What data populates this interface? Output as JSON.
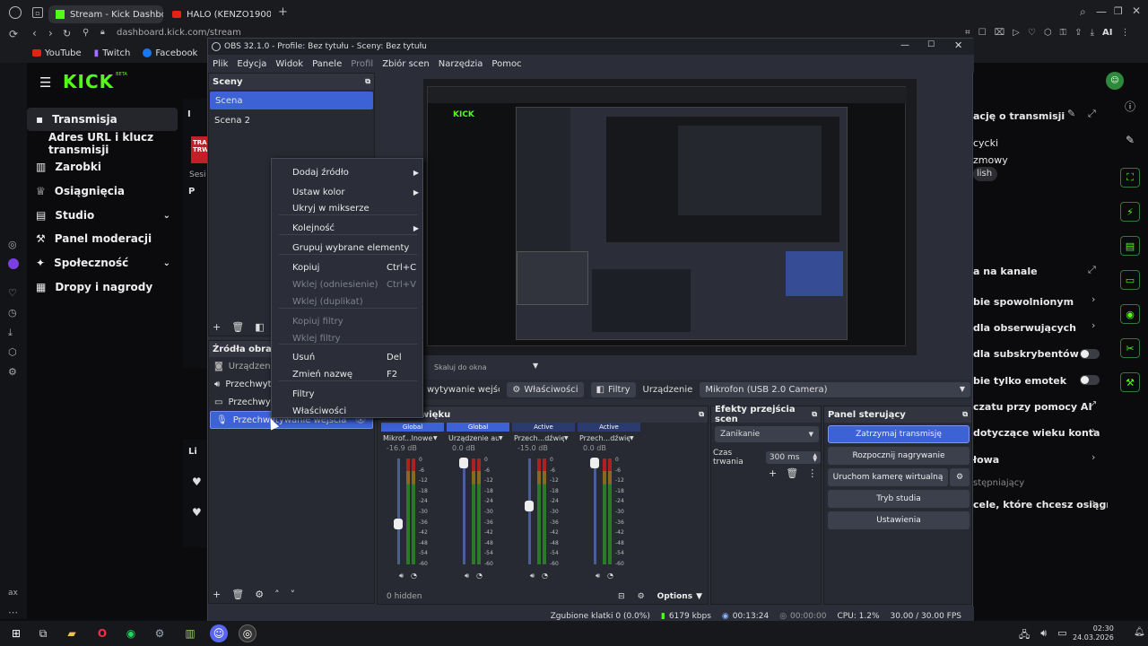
{
  "browser": {
    "tabs": [
      {
        "title": "Stream - Kick Dashboard"
      },
      {
        "title": "HALO (KENZO1900X) ORG"
      }
    ],
    "url": "dashboard.kick.com/stream",
    "url_host": "kick.com",
    "bookmarks": [
      "YouTube",
      "Twitch",
      "Facebook",
      "Oc"
    ],
    "ai_label": "AI"
  },
  "kick": {
    "logo": "KICK",
    "logo_sub": "BETA",
    "nav": [
      {
        "label": "Transmisja",
        "icon": "broadcast-icon"
      },
      {
        "label": "Adres URL i klucz transmisji",
        "icon": ""
      },
      {
        "label": "Zarobki",
        "icon": "chart-icon"
      },
      {
        "label": "Osiągnięcia",
        "icon": "trophy-icon"
      },
      {
        "label": "Studio",
        "icon": "studio-icon"
      },
      {
        "label": "Panel moderacji",
        "icon": "wrench-icon"
      },
      {
        "label": "Społeczność",
        "icon": "community-icon"
      },
      {
        "label": "Dropy i nagrody",
        "icon": "gift-icon"
      }
    ],
    "peek": {
      "i": "I",
      "tra": "TRA",
      "trw": "TRW",
      "sesi": "Sesi",
      "p": "P",
      "li": "Li"
    },
    "right": {
      "info_title": "ację o transmisji",
      "items1": [
        "cycki",
        "zmowy",
        "lish"
      ],
      "channel_title": "a na kanale",
      "items2": [
        "bie spowolnionym",
        "dla obserwujących",
        "dla subskrybentów",
        "bie tylko emotek",
        "czatu przy pomocy AI",
        "dotyczące wieku konta",
        "łowa",
        "stępniający",
        "cele, które chcesz osiągnąć"
      ]
    }
  },
  "obs": {
    "title": "OBS 32.1.0 - Profile: Bez tytułu - Sceny: Bez tytułu",
    "menu": [
      "Plik",
      "Edycja",
      "Widok",
      "Panele",
      "Profil",
      "Zbiór scen",
      "Narzędzia",
      "Pomoc"
    ],
    "scenes_title": "Sceny",
    "scenes": [
      "Scena",
      "Scena 2"
    ],
    "sources_title": "Źródła obrazu",
    "sources": [
      "Urządzenie c",
      "Przechwyty",
      "Przechwyty",
      "Przechwytywanie wejścia dźwię"
    ],
    "context_menu": [
      {
        "label": "Dodaj źródło",
        "shortcut": "",
        "submenu": true,
        "disabled": false
      },
      {
        "label": "Ustaw kolor",
        "shortcut": "",
        "submenu": true,
        "disabled": false
      },
      {
        "label": "Ukryj w mikserze",
        "shortcut": "",
        "submenu": false,
        "disabled": false
      },
      {
        "label": "Kolejność",
        "shortcut": "",
        "submenu": true,
        "disabled": false
      },
      {
        "label": "Grupuj wybrane elementy",
        "shortcut": "",
        "submenu": false,
        "disabled": false
      },
      {
        "label": "Kopiuj",
        "shortcut": "Ctrl+C",
        "submenu": false,
        "disabled": false
      },
      {
        "label": "Wklej (odniesienie)",
        "shortcut": "Ctrl+V",
        "submenu": false,
        "disabled": true
      },
      {
        "label": "Wklej (duplikat)",
        "shortcut": "",
        "submenu": false,
        "disabled": true
      },
      {
        "label": "Kopiuj filtry",
        "shortcut": "",
        "submenu": false,
        "disabled": true
      },
      {
        "label": "Wklej filtry",
        "shortcut": "",
        "submenu": false,
        "disabled": true
      },
      {
        "label": "Usuń",
        "shortcut": "Del",
        "submenu": false,
        "disabled": false
      },
      {
        "label": "Zmień nazwę",
        "shortcut": "F2",
        "submenu": false,
        "disabled": false
      },
      {
        "label": "Filtry",
        "shortcut": "",
        "submenu": false,
        "disabled": false
      },
      {
        "label": "Właściwości",
        "shortcut": "",
        "submenu": false,
        "disabled": false
      }
    ],
    "preview_caption": "Skaluj do okna",
    "toolbar": {
      "source_name": "wytywanie wejścia d",
      "properties": "Właściwości",
      "filters": "Filtry",
      "device_label": "Urządzenie",
      "device_value": "Mikrofon (USB 2.0 Camera)"
    },
    "mixer": {
      "title": "więku",
      "channels": [
        {
          "tag": "Global",
          "name": "Mikrof...lnowe",
          "db": "-16.9 dB",
          "level": 0.62
        },
        {
          "tag": "Global",
          "name": "Urządzenie audio",
          "db": "0.0 dB",
          "level": 0.04
        },
        {
          "tag": "Active",
          "name": "Przech...dźwięku",
          "db": "-15.0 dB",
          "level": 0.45
        },
        {
          "tag": "Active",
          "name": "Przech...dźwięku",
          "db": "0.0 dB",
          "level": 0.04
        }
      ],
      "scale": [
        "0",
        "-6",
        "-12",
        "-18",
        "-24",
        "-30",
        "-36",
        "-42",
        "-48",
        "-54",
        "-60"
      ],
      "hidden": "0 hidden",
      "options": "Options"
    },
    "transitions": {
      "title": "Efekty przejścia scen",
      "type": "Zanikanie",
      "duration_label": "Czas trwania",
      "duration": "300 ms"
    },
    "controls": {
      "title": "Panel sterujący",
      "stop": "Zatrzymaj transmisję",
      "record": "Rozpocznij nagrywanie",
      "vcam": "Uruchom kamerę wirtualną",
      "studio": "Tryb studia",
      "settings": "Ustawienia"
    },
    "status": {
      "dropped": "Zgubione klatki 0 (0.0%)",
      "bitrate": "6179 kbps",
      "live": "00:13:24",
      "rec": "00:00:00",
      "cpu": "CPU: 1.2%",
      "fps": "30.00 / 30.00 FPS"
    }
  },
  "taskbar": {
    "time": "02:30",
    "date": "24.03.2026",
    "ax": "ax"
  },
  "colors": {
    "accent": "#53fc18",
    "obs_blue": "#3d62d6",
    "live_red": "#c21f27"
  }
}
